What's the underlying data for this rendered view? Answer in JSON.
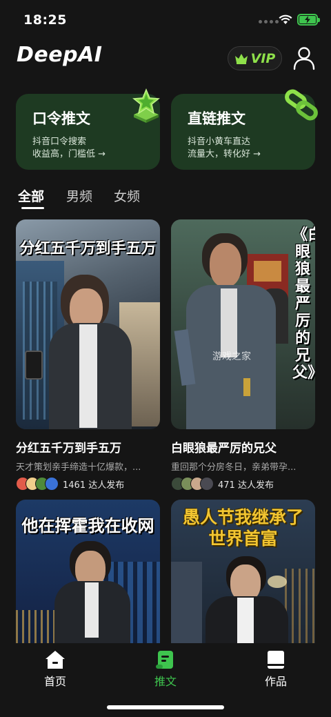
{
  "status": {
    "time": "18:25"
  },
  "header": {
    "logo": "DeepAI",
    "vip_label": "VIP"
  },
  "promos": [
    {
      "title": "口令推文",
      "line1": "抖音口令搜索",
      "line2": "收益高，门槛低 →",
      "icon": "trophy-star-icon"
    },
    {
      "title": "直链推文",
      "line1": "抖音小黄车直达",
      "line2": "流量大，转化好 →",
      "icon": "chain-link-icon"
    }
  ],
  "tabs": [
    "全部",
    "男频",
    "女频"
  ],
  "active_tab": "全部",
  "cards": [
    {
      "cover_text": "分红五千万到手五万",
      "title": "分红五千万到手五万",
      "desc": "天才策划亲手缔造十亿爆款，...",
      "count": "1461 达人发布"
    },
    {
      "cover_text": "《白眼狼最严厉的兄父》",
      "title": "白眼狼最严厉的兄父",
      "desc": "重回那个分房冬日，亲弟带孕...",
      "count": "471 达人发布"
    },
    {
      "cover_text": "他在挥霍我在收网",
      "title": "",
      "desc": "",
      "count": ""
    },
    {
      "cover_text": "愚人节我继承了世界首富",
      "title": "",
      "desc": "",
      "count": ""
    }
  ],
  "watermark": "游戏之家",
  "nav": [
    "首页",
    "推文",
    "作品"
  ],
  "active_nav": "推文",
  "colors": {
    "accent": "#3ec44e",
    "promo_bg": "#1e3a22",
    "background": "#151515"
  }
}
